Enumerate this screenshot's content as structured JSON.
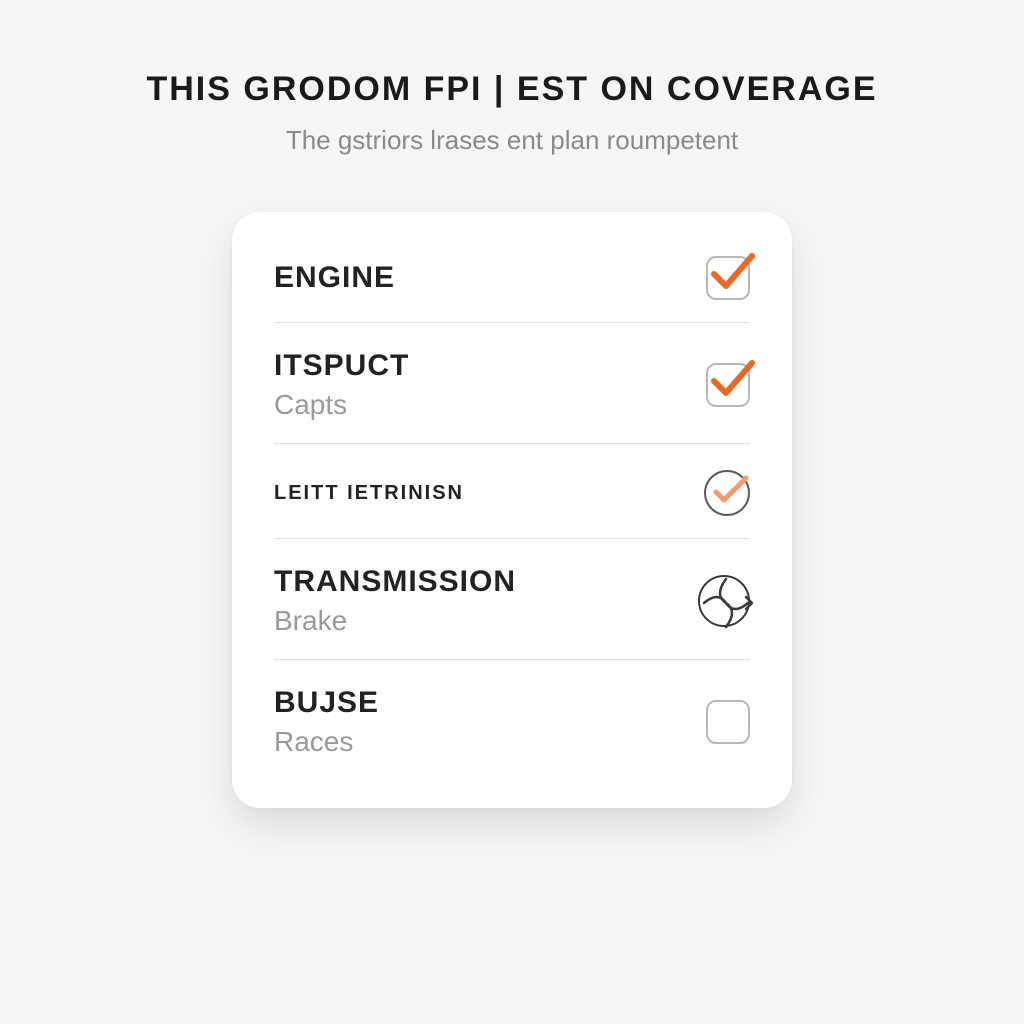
{
  "header": {
    "title": "THIS GRODOM FPI | EST ON COVERAGE",
    "subtitle": "The gstriors lrases ent plan roumpetent"
  },
  "items": [
    {
      "label": "ENGINE",
      "sub": "",
      "indicator": "box-check"
    },
    {
      "label": "ITSPUCT",
      "sub": "Capts",
      "indicator": "box-check"
    },
    {
      "label": "LEITT IETRINISN",
      "sub": "",
      "indicator": "circle-check",
      "small": true
    },
    {
      "label": "TRANSMISSION",
      "sub": "Brake",
      "indicator": "globe"
    },
    {
      "label": "BUJSE",
      "sub": "Races",
      "indicator": "box-empty"
    }
  ],
  "colors": {
    "accent": "#e96a25",
    "accentLight": "#f19b72"
  }
}
